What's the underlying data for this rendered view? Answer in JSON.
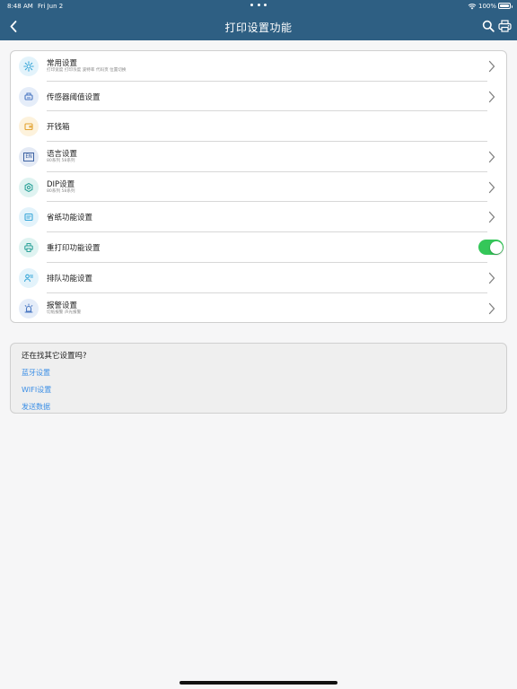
{
  "status_bar": {
    "time": "8:48 AM",
    "date": "Fri Jun 2",
    "battery": "100%"
  },
  "nav": {
    "title": "打印设置功能",
    "icons": [
      "back-arrow-icon",
      "search-icon",
      "printer-icon"
    ]
  },
  "settings": {
    "items": [
      {
        "title": "常用设置",
        "subtitle": "打印宽度 打印浓度 波特率 代码页 位置切换",
        "icon": "gear-icon",
        "icon_color": "#3aa7d8",
        "icon_bg": "#e3f3fb",
        "chevron": true
      },
      {
        "title": "传感器阈值设置",
        "subtitle": "",
        "icon": "sensor-icon",
        "icon_color": "#4a78c2",
        "icon_bg": "#e5edf9",
        "chevron": true
      },
      {
        "title": "开钱箱",
        "subtitle": "",
        "icon": "cash-drawer-icon",
        "icon_color": "#e2a230",
        "icon_bg": "#fdf2dc",
        "chevron": false
      },
      {
        "title": "语言设置",
        "subtitle": "80系列 58系列",
        "icon": "language-en-icon",
        "icon_color": "#3e63a3",
        "icon_bg": "#e4eaf5",
        "chevron": true,
        "icon_text": "EN"
      },
      {
        "title": "DIP设置",
        "subtitle": "80系列 58系列",
        "icon": "dip-gear-icon",
        "icon_color": "#2fa39a",
        "icon_bg": "#dff3f1",
        "chevron": true
      },
      {
        "title": "省纸功能设置",
        "subtitle": "",
        "icon": "paper-save-icon",
        "icon_color": "#3aa7d8",
        "icon_bg": "#e3f3fb",
        "chevron": true
      },
      {
        "title": "重打印功能设置",
        "subtitle": "",
        "icon": "reprint-icon",
        "icon_color": "#2fa39a",
        "icon_bg": "#dff3f1",
        "chevron": false,
        "toggle": true,
        "toggle_on": true
      },
      {
        "title": "排队功能设置",
        "subtitle": "",
        "icon": "queue-icon",
        "icon_color": "#3aa7d8",
        "icon_bg": "#e3f3fb",
        "chevron": true
      },
      {
        "title": "报警设置",
        "subtitle": "切纸报警 声光报警",
        "icon": "alarm-icon",
        "icon_color": "#4a78c2",
        "icon_bg": "#e5edf9",
        "chevron": true
      }
    ]
  },
  "more": {
    "title": "还在找其它设置吗?",
    "links": [
      "蓝牙设置",
      "WIFI设置",
      "发送数据"
    ]
  },
  "colors": {
    "nav_bg": "#2e5f83",
    "link": "#3a8ee6",
    "toggle_on": "#34c759"
  }
}
